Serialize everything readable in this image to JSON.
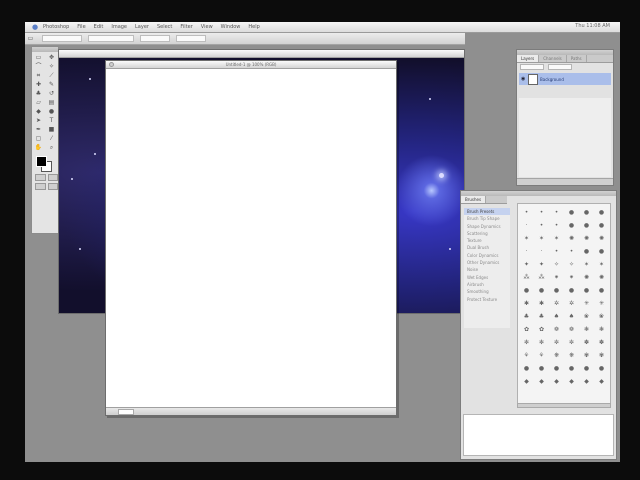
{
  "menubar": {
    "app_name": "Photoshop",
    "items": [
      "File",
      "Edit",
      "Image",
      "Layer",
      "Select",
      "Filter",
      "View",
      "Window",
      "Help"
    ],
    "clock": "Thu 11:08 AM"
  },
  "optbar": {
    "field1": "",
    "field2": ""
  },
  "toolbox": {
    "tools": [
      {
        "icon": "marquee-icon",
        "g": "▭"
      },
      {
        "icon": "move-icon",
        "g": "✥"
      },
      {
        "icon": "lasso-icon",
        "g": "⌒"
      },
      {
        "icon": "magic-wand-icon",
        "g": "✧"
      },
      {
        "icon": "crop-icon",
        "g": "⌗"
      },
      {
        "icon": "slice-icon",
        "g": "⟋"
      },
      {
        "icon": "healing-brush-icon",
        "g": "✚"
      },
      {
        "icon": "brush-icon",
        "g": "✎"
      },
      {
        "icon": "clone-stamp-icon",
        "g": "♣"
      },
      {
        "icon": "history-brush-icon",
        "g": "↺"
      },
      {
        "icon": "eraser-icon",
        "g": "▱"
      },
      {
        "icon": "gradient-icon",
        "g": "▤"
      },
      {
        "icon": "blur-icon",
        "g": "◆"
      },
      {
        "icon": "dodge-icon",
        "g": "●"
      },
      {
        "icon": "path-select-icon",
        "g": "➤"
      },
      {
        "icon": "type-icon",
        "g": "T"
      },
      {
        "icon": "pen-icon",
        "g": "✒"
      },
      {
        "icon": "shape-icon",
        "g": "■"
      },
      {
        "icon": "notes-icon",
        "g": "▢"
      },
      {
        "icon": "eyedropper-icon",
        "g": "⁄"
      },
      {
        "icon": "hand-icon",
        "g": "✋"
      },
      {
        "icon": "zoom-icon",
        "g": "⌕"
      }
    ]
  },
  "space_doc": {
    "title": ""
  },
  "new_doc": {
    "title": "Untitled-1 @ 100% (RGB)",
    "zoom": "",
    "status": ""
  },
  "layers": {
    "tabs": [
      "Layers",
      "Channels",
      "Paths"
    ],
    "layer_name": "Background"
  },
  "brushes": {
    "title": "Brushes",
    "list": [
      "Brush Presets",
      "Brush Tip Shape",
      "Shape Dynamics",
      "Scattering",
      "Texture",
      "Dual Brush",
      "Color Dynamics",
      "Other Dynamics",
      "Noise",
      "Wet Edges",
      "Airbrush",
      "Smoothing",
      "Protect Texture"
    ],
    "grid": [
      "•",
      "•",
      "•",
      "●",
      "●",
      "●",
      "·",
      "•",
      "•",
      "●",
      "●",
      "●",
      "✶",
      "✶",
      "✶",
      "✺",
      "✺",
      "✺",
      "·",
      "·",
      "•",
      "•",
      "●",
      "●",
      "✦",
      "✦",
      "✧",
      "✧",
      "✶",
      "✶",
      "⁂",
      "⁂",
      "⁕",
      "⁕",
      "✺",
      "✺",
      "●",
      "●",
      "●",
      "●",
      "●",
      "●",
      "✱",
      "✱",
      "✲",
      "✲",
      "✳",
      "✳",
      "♣",
      "♣",
      "♠",
      "♠",
      "❀",
      "❀",
      "✿",
      "✿",
      "❁",
      "❁",
      "❃",
      "❃",
      "✻",
      "✻",
      "✼",
      "✼",
      "✽",
      "✽",
      "⚘",
      "⚘",
      "❋",
      "❋",
      "✾",
      "✾",
      "●",
      "●",
      "●",
      "●",
      "●",
      "●",
      "◆",
      "◆",
      "◆",
      "◆",
      "◆",
      "◆"
    ]
  }
}
